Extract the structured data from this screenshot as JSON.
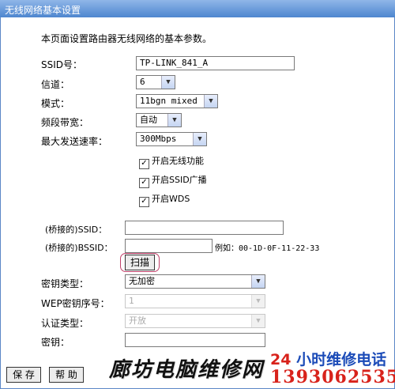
{
  "window": {
    "title": "无线网络基本设置"
  },
  "description": "本页面设置路由器无线网络的基本参数。",
  "form": {
    "ssid_label": "SSID号：",
    "ssid_value": "TP-LINK_841_A",
    "channel_label": "信道：",
    "channel_value": "6",
    "mode_label": "模式：",
    "mode_value": "11bgn mixed",
    "bandwidth_label": "频段带宽：",
    "bandwidth_value": "自动",
    "max_rate_label": "最大发送速率：",
    "max_rate_value": "300Mbps",
    "enable_wireless_label": "开启无线功能",
    "enable_wireless_checked": true,
    "enable_ssid_broadcast_label": "开启SSID广播",
    "enable_ssid_broadcast_checked": true,
    "enable_wds_label": "开启WDS",
    "enable_wds_checked": true,
    "bridged_ssid_label": "(桥接的)SSID：",
    "bridged_ssid_value": "",
    "bridged_bssid_label": "(桥接的)BSSID：",
    "bridged_bssid_value": "",
    "bssid_example": "例如：00-1D-0F-11-22-33",
    "scan_button": "扫描",
    "key_type_label": "密钥类型：",
    "key_type_value": "无加密",
    "wep_index_label": "WEP密钥序号：",
    "wep_index_value": "1",
    "auth_type_label": "认证类型：",
    "auth_type_value": "开放",
    "key_label": "密钥：",
    "key_value": ""
  },
  "footer": {
    "save_button": "保 存",
    "help_button": "帮 助"
  },
  "watermark": {
    "shop_name": "廊坊电脑维修网",
    "hotline_number": "24",
    "hotline_text": "小时维修电话",
    "phone": "13930625357"
  }
}
